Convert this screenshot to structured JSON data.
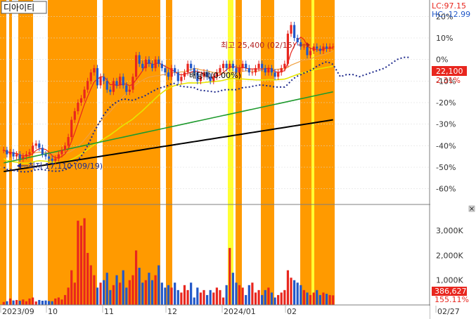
{
  "title": "디아이티",
  "colors": {
    "band_orange": "#ff9a00",
    "band_yellow": "#ffff33",
    "candle_up": "#e8261e",
    "candle_down": "#2258c8",
    "ma5": "#e8261e",
    "ma20": "#f0a040",
    "ma60": "#e6e600",
    "ma120": "#1f9a2e",
    "ma240": "#000000",
    "forecast": "#1e2a8c",
    "price_box": "#e8261e",
    "volume_box": "#e8261e"
  },
  "header": {
    "lc": "LC:97.15",
    "hc": "HC:-12.99"
  },
  "annotations": {
    "high": "최고 25,400 (02/15)",
    "low": "최저 17,110 (09/19)",
    "dividend": "배당락(0.00%)"
  },
  "price_panel": {
    "current": "22,100",
    "change": "2.31%",
    "y_ticks": [
      "20%",
      "10%",
      "0%",
      "-10%",
      "-20%",
      "-30%",
      "-40%",
      "-50%",
      "-60%"
    ]
  },
  "volume_panel": {
    "current": "386,627",
    "change": "155.11%",
    "y_ticks": [
      "3,000K",
      "2,000K",
      "1,000K"
    ],
    "close_icon": "close-icon"
  },
  "x_axis": {
    "labels": [
      "2023/09",
      "10",
      "11",
      "12",
      "2024/01",
      "02",
      "02/27"
    ]
  },
  "chart_data": {
    "type": "candlestick",
    "title": "디아이티",
    "ylabel": "",
    "ylim": [
      -65,
      25
    ],
    "volume_ylim": [
      0,
      3800
    ],
    "volume_unit": "K",
    "last_close": 22100,
    "high": {
      "value": 25400,
      "date": "02/15"
    },
    "low": {
      "value": 17110,
      "date": "09/19"
    },
    "series": [
      {
        "values": [
          -42,
          -44,
          -43,
          -45,
          -44,
          -46,
          -45,
          -44,
          -43,
          -40,
          -39,
          -41,
          -44,
          -45,
          -46,
          -47,
          -46,
          -44,
          -42,
          -40,
          -36,
          -28,
          -24,
          -20,
          -18,
          -14,
          -10,
          -6,
          -4,
          -12,
          -8,
          -10,
          -14,
          -15,
          -10,
          -12,
          -8,
          -12,
          -15,
          -14,
          -8,
          2,
          -2,
          -4,
          0,
          -2,
          -4,
          0,
          -2,
          -4,
          -6,
          -8,
          -4,
          -6,
          -10,
          -8,
          -6,
          -2,
          -4,
          -6,
          -10,
          -8,
          -6,
          -8,
          -10,
          -8,
          -6,
          -4,
          -2,
          -4,
          -2,
          -4,
          -6,
          -4,
          -2,
          -4,
          -6,
          -6,
          -4,
          -2,
          -4,
          -6,
          -4,
          -6,
          -8,
          -6,
          -4,
          -2,
          12,
          16,
          10,
          8,
          6,
          6,
          2,
          4,
          6,
          5,
          4,
          6,
          5,
          6,
          6
        ],
        "volume": [
          120,
          150,
          260,
          180,
          200,
          170,
          220,
          150,
          260,
          300,
          140,
          200,
          170,
          180,
          160,
          150,
          260,
          300,
          220,
          400,
          700,
          1400,
          900,
          3400,
          3200,
          3500,
          2100,
          1600,
          1200,
          700,
          900,
          1000,
          1300,
          600,
          800,
          1200,
          900,
          1400,
          700,
          1000,
          1200,
          2200,
          1500,
          900,
          1000,
          1300,
          1000,
          1200,
          1600,
          900,
          700,
          800,
          700,
          900,
          600,
          500,
          800,
          600,
          900,
          300,
          700,
          500,
          600,
          400,
          600,
          500,
          700,
          600,
          300,
          800,
          2300,
          1300,
          900,
          800,
          700,
          400,
          800,
          900,
          500,
          600,
          400,
          600,
          700,
          500,
          300,
          400,
          500,
          600,
          1400,
          1100,
          1000,
          900,
          800,
          600,
          500,
          400,
          500,
          600,
          400,
          500,
          450,
          400,
          387
        ]
      }
    ],
    "moving_average_labels": [],
    "forecast_values": [
      -8,
      -7,
      -7,
      -8,
      -7,
      -6,
      -5,
      -4,
      -2,
      0,
      1,
      1
    ],
    "y_ticks": [
      "20%",
      "10%",
      "0%",
      "-10%",
      "-20%",
      "-30%",
      "-40%",
      "-50%",
      "-60%"
    ],
    "x_labels": [
      "2023/09",
      "10",
      "11",
      "12",
      "2024/01",
      "02",
      "02/27"
    ]
  }
}
